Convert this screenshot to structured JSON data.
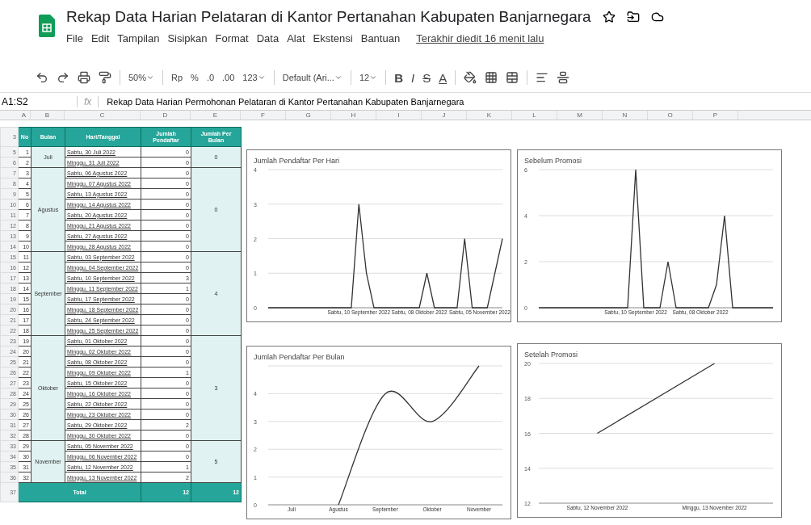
{
  "document": {
    "title": "Rekap Data Harian Pelataran di Kantor Pertanahan Kabupaten Banjarnegara",
    "last_edit": "Terakhir diedit 16 menit lalu"
  },
  "menu": [
    "File",
    "Edit",
    "Tampilan",
    "Sisipkan",
    "Format",
    "Data",
    "Alat",
    "Ekstensi",
    "Bantuan"
  ],
  "toolbar": {
    "zoom": "50%",
    "currency": "Rp",
    "percent": "%",
    "decimals_less": ".0",
    "decimals_more": ".00",
    "number_format": "123",
    "font": "Default (Ari...",
    "font_size": "12",
    "bold": "B",
    "italic": "I",
    "strike": "S",
    "text_color": "A"
  },
  "formula_bar": {
    "cell_ref": "A1:S2",
    "fx": "fx",
    "formula": "Rekap Data Harian Permohonan Pelataran di Kantor Pertanahan Kabupaten Banjarnegara"
  },
  "columns": [
    "A",
    "B",
    "C",
    "D",
    "E",
    "F",
    "G",
    "H",
    "I",
    "J",
    "K",
    "L",
    "M",
    "N",
    "O",
    "P"
  ],
  "table": {
    "header_row": "3",
    "total_row": "37",
    "headers": [
      "No",
      "Bulan",
      "Hari/Tanggal",
      "Jumlah Pendaftar",
      "Jumlah Per Bulan"
    ],
    "months": [
      {
        "name": "Juli",
        "total": "0",
        "rows": [
          [
            "5",
            "1",
            "Sabtu, 30 Juli 2022",
            "0"
          ],
          [
            "6",
            "2",
            "Minggu, 31 Juli 2022",
            "0"
          ]
        ]
      },
      {
        "name": "Agustus",
        "total": "0",
        "rows": [
          [
            "7",
            "3",
            "Sabtu, 06 Agustus 2022",
            "0"
          ],
          [
            "8",
            "4",
            "Minggu, 07 Agustus 2022",
            "0"
          ],
          [
            "9",
            "5",
            "Sabtu, 13 Agustus 2022",
            "0"
          ],
          [
            "10",
            "6",
            "Minggu, 14 Agustus 2022",
            "0"
          ],
          [
            "11",
            "7",
            "Sabtu, 20 Agustus 2022",
            "0"
          ],
          [
            "12",
            "8",
            "Minggu, 21 Agustus 2022",
            "0"
          ],
          [
            "13",
            "9",
            "Sabtu, 27 Agustus 2022",
            "0"
          ],
          [
            "14",
            "10",
            "Minggu, 28 Agustus 2022",
            "0"
          ]
        ]
      },
      {
        "name": "September",
        "total": "4",
        "rows": [
          [
            "15",
            "11",
            "Sabtu, 03 September 2022",
            "0"
          ],
          [
            "16",
            "12",
            "Minggu, 04 September 2022",
            "0"
          ],
          [
            "17",
            "13",
            "Sabtu, 10 September 2022",
            "3"
          ],
          [
            "18",
            "14",
            "Minggu, 11 September 2022",
            "1"
          ],
          [
            "19",
            "15",
            "Sabtu, 17 September 2022",
            "0"
          ],
          [
            "20",
            "16",
            "Minggu, 18 September 2022",
            "0"
          ],
          [
            "21",
            "17",
            "Sabtu, 24 September 2022",
            "0"
          ],
          [
            "22",
            "18",
            "Minggu, 25 September 2022",
            "0"
          ]
        ]
      },
      {
        "name": "Oktober",
        "total": "3",
        "rows": [
          [
            "23",
            "19",
            "Sabtu, 01 Oktober 2022",
            "0"
          ],
          [
            "24",
            "20",
            "Minggu, 02 Oktober 2022",
            "0"
          ],
          [
            "25",
            "21",
            "Sabtu, 08 Oktober 2022",
            "0"
          ],
          [
            "26",
            "22",
            "Minggu, 09 Oktober 2022",
            "1"
          ],
          [
            "27",
            "23",
            "Sabtu, 15 Oktober 2022",
            "0"
          ],
          [
            "28",
            "24",
            "Minggu, 16 Oktober 2022",
            "0"
          ],
          [
            "29",
            "25",
            "Sabtu, 22 Oktober 2022",
            "0"
          ],
          [
            "30",
            "26",
            "Minggu, 23 Oktober 2022",
            "0"
          ],
          [
            "31",
            "27",
            "Sabtu, 29 Oktober 2022",
            "2"
          ],
          [
            "32",
            "28",
            "Minggu, 30 Oktober 2022",
            "0"
          ]
        ]
      },
      {
        "name": "November",
        "total": "5",
        "rows": [
          [
            "33",
            "29",
            "Sabtu, 05 November 2022",
            "0"
          ],
          [
            "34",
            "30",
            "Minggu, 06 November 2022",
            "0"
          ],
          [
            "35",
            "31",
            "Sabtu, 12 November 2022",
            "1"
          ],
          [
            "36",
            "32",
            "Minggu, 13 November 2022",
            "2"
          ]
        ]
      }
    ],
    "total_label": "Total",
    "total_value": "12",
    "total_month": "12"
  },
  "charts": [
    {
      "chart_data": {
        "type": "line",
        "title": "Jumlah Pendaftar Per Hari",
        "grid": true,
        "ylim": [
          0,
          4
        ],
        "yticks": [
          4,
          3,
          2,
          1,
          0
        ],
        "categories": [
          null,
          null,
          null,
          null,
          null,
          null,
          null,
          null,
          null,
          null,
          null,
          null,
          "Sabtu, 10 September 2022",
          null,
          null,
          null,
          null,
          null,
          null,
          null,
          "Sabtu, 08 Oktober 2022",
          null,
          null,
          null,
          null,
          null,
          null,
          null,
          "Sabtu, 05 November 2022",
          null,
          null,
          null
        ],
        "series": [
          {
            "color": "#333333",
            "values": [
              0,
              0,
              0,
              0,
              0,
              0,
              0,
              0,
              0,
              0,
              0,
              0,
              3,
              1,
              0,
              0,
              0,
              0,
              0,
              0,
              0,
              1,
              0,
              0,
              0,
              0,
              2,
              0,
              0,
              0,
              1,
              2
            ]
          }
        ]
      }
    },
    {
      "chart_data": {
        "type": "line",
        "title": "Sebelum Promosi",
        "grid": true,
        "ylim": [
          0,
          6
        ],
        "yticks": [
          6,
          4,
          2,
          0
        ],
        "categories": [
          null,
          null,
          null,
          null,
          null,
          null,
          null,
          null,
          null,
          null,
          null,
          null,
          "Sabtu, 10 September 2022",
          null,
          null,
          null,
          null,
          null,
          null,
          null,
          "Sabtu, 08 Oktober 2022",
          null,
          null,
          null,
          null,
          null,
          null,
          null,
          null,
          null
        ],
        "series": [
          {
            "color": "#333333",
            "values": [
              0,
              0,
              0,
              0,
              0,
              0,
              0,
              0,
              0,
              0,
              0,
              0,
              6,
              0,
              0,
              0,
              2,
              0,
              0,
              0,
              0,
              0,
              1,
              4,
              0,
              0,
              0,
              0,
              0,
              0
            ]
          }
        ]
      }
    },
    {
      "chart_data": {
        "type": "line",
        "title": "Jumlah Pendaftar Per Bulan",
        "grid": true,
        "ylim": [
          0,
          5
        ],
        "yticks": [
          4,
          3,
          2,
          1,
          0
        ],
        "categories": [
          "Juli",
          "Agustus",
          "September",
          "Oktober",
          "November"
        ],
        "series": [
          {
            "color": "#333333",
            "values": [
              null,
              0,
              4,
              3,
              5
            ]
          }
        ]
      }
    },
    {
      "chart_data": {
        "type": "line",
        "title": "Setelah Promosi",
        "grid": true,
        "ylim": [
          12,
          20
        ],
        "yticks": [
          20,
          18,
          16,
          14,
          12
        ],
        "categories": [
          "Sabtu, 12 November 2022",
          "Minggu, 13 November 2022"
        ],
        "series": [
          {
            "color": "#333333",
            "values": [
              16,
              20
            ]
          }
        ]
      }
    }
  ]
}
